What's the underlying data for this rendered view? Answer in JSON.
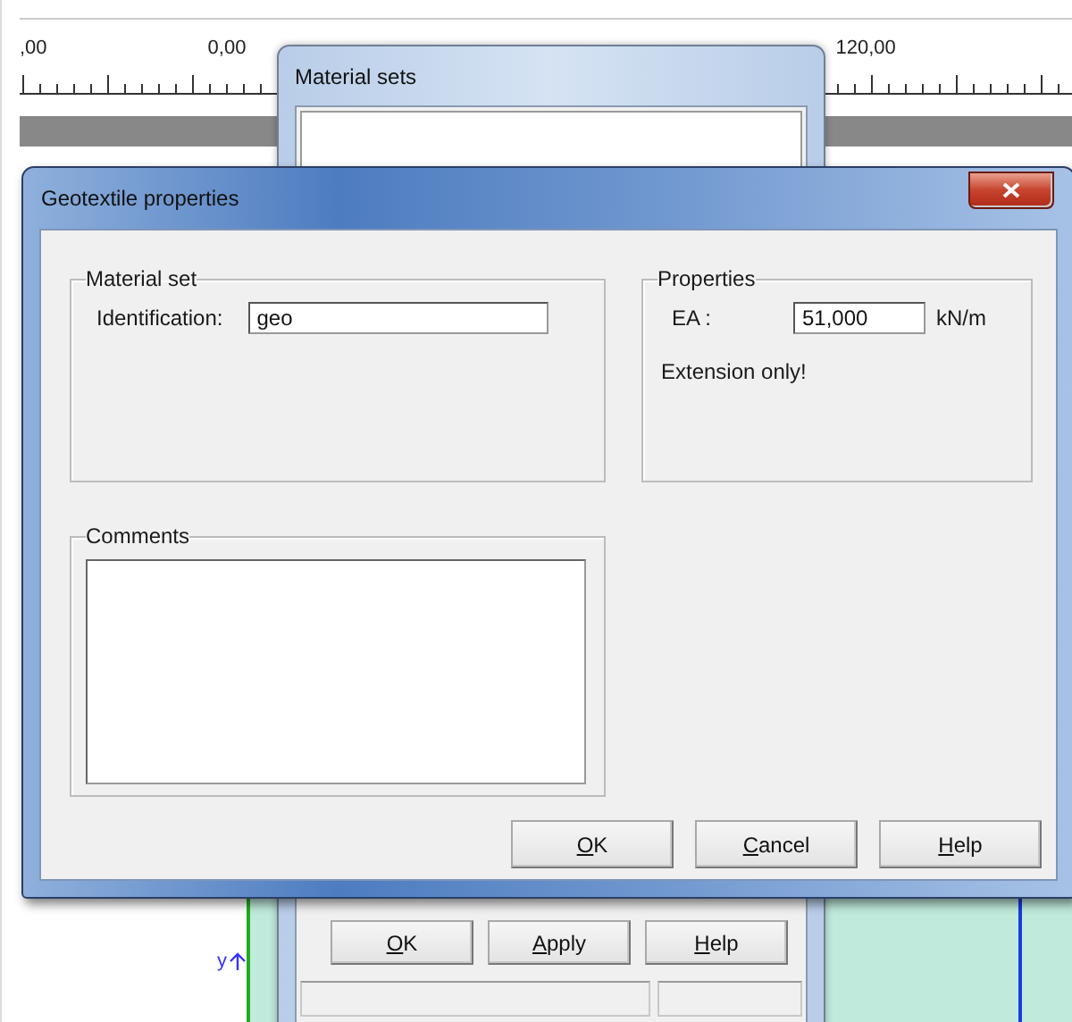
{
  "background": {
    "ruler_labels": [
      ",00",
      "0,00",
      "120,00"
    ],
    "axis_label": "y"
  },
  "material_sets": {
    "title": "Material sets",
    "buttons": [
      "OK",
      "Apply",
      "Help"
    ]
  },
  "dialog": {
    "title": "Geotextile properties",
    "material_set": {
      "title": "Material set",
      "label": "Identification:",
      "value": "geo"
    },
    "properties": {
      "title": "Properties",
      "label": "EA :",
      "value": "51,000",
      "unit": "kN/m",
      "note": "Extension only!"
    },
    "comments": {
      "title": "Comments"
    },
    "buttons": [
      "OK",
      "Cancel",
      "Help"
    ]
  }
}
